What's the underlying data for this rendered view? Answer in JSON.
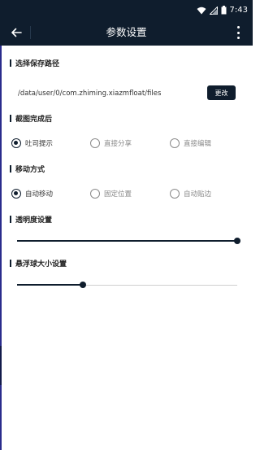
{
  "status_bar": {
    "time": "7:43",
    "icons": [
      "wifi-icon",
      "signal-icon",
      "battery-icon"
    ]
  },
  "app_bar": {
    "back_icon": "arrow-left-icon",
    "title": "参数设置",
    "more_icon": "more-vertical-icon"
  },
  "save_path": {
    "title": "选择保存路径",
    "path": "/data/user/0/com.zhiming.xiazmfloat/files",
    "button_label": "更改"
  },
  "after_capture": {
    "title": "截图完成后",
    "options": [
      {
        "label": "吐司提示",
        "checked": true
      },
      {
        "label": "直接分享",
        "checked": false
      },
      {
        "label": "直接编辑",
        "checked": false
      }
    ]
  },
  "move_mode": {
    "title": "移动方式",
    "options": [
      {
        "label": "自动移动",
        "checked": true
      },
      {
        "label": "固定位置",
        "checked": false
      },
      {
        "label": "自动贴边",
        "checked": false
      }
    ]
  },
  "transparency": {
    "title": "透明度设置",
    "value": 1.0
  },
  "ball_size": {
    "title": "悬浮球大小设置",
    "value": 0.3
  },
  "colors": {
    "primary": "#0f1d2d",
    "track": "#cfcfcf"
  }
}
